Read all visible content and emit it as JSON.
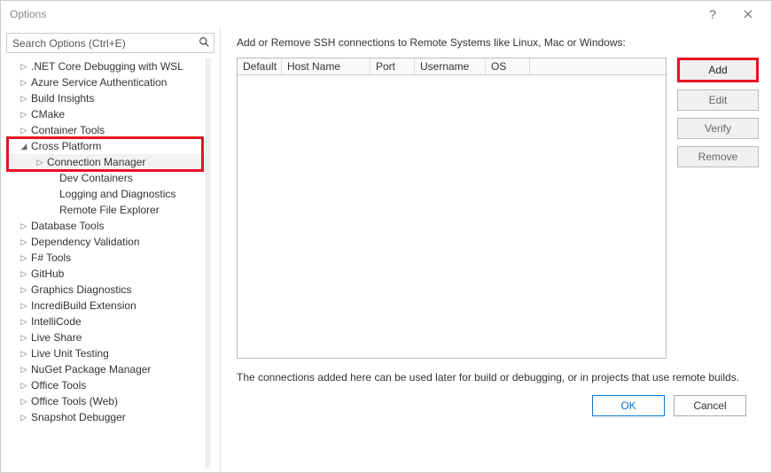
{
  "window": {
    "title": "Options"
  },
  "search": {
    "placeholder": "Search Options (Ctrl+E)"
  },
  "tree": {
    "items": [
      {
        "label": ".NET Core Debugging with WSL",
        "depth": 1,
        "arrow": "right"
      },
      {
        "label": "Azure Service Authentication",
        "depth": 1,
        "arrow": "right"
      },
      {
        "label": "Build Insights",
        "depth": 1,
        "arrow": "right"
      },
      {
        "label": "CMake",
        "depth": 1,
        "arrow": "right"
      },
      {
        "label": "Container Tools",
        "depth": 1,
        "arrow": "right"
      },
      {
        "label": "Cross Platform",
        "depth": 1,
        "arrow": "down",
        "expanded": true,
        "box": true
      },
      {
        "label": "Connection Manager",
        "depth": 2,
        "arrow": "right",
        "selected": true,
        "box": true
      },
      {
        "label": "Dev Containers",
        "depth": 2,
        "arrow": "none"
      },
      {
        "label": "Logging and Diagnostics",
        "depth": 2,
        "arrow": "none"
      },
      {
        "label": "Remote File Explorer",
        "depth": 2,
        "arrow": "none"
      },
      {
        "label": "Database Tools",
        "depth": 1,
        "arrow": "right"
      },
      {
        "label": "Dependency Validation",
        "depth": 1,
        "arrow": "right"
      },
      {
        "label": "F# Tools",
        "depth": 1,
        "arrow": "right"
      },
      {
        "label": "GitHub",
        "depth": 1,
        "arrow": "right"
      },
      {
        "label": "Graphics Diagnostics",
        "depth": 1,
        "arrow": "right"
      },
      {
        "label": "IncrediBuild Extension",
        "depth": 1,
        "arrow": "right"
      },
      {
        "label": "IntelliCode",
        "depth": 1,
        "arrow": "right"
      },
      {
        "label": "Live Share",
        "depth": 1,
        "arrow": "right"
      },
      {
        "label": "Live Unit Testing",
        "depth": 1,
        "arrow": "right"
      },
      {
        "label": "NuGet Package Manager",
        "depth": 1,
        "arrow": "right"
      },
      {
        "label": "Office Tools",
        "depth": 1,
        "arrow": "right"
      },
      {
        "label": "Office Tools (Web)",
        "depth": 1,
        "arrow": "right"
      },
      {
        "label": "Snapshot Debugger",
        "depth": 1,
        "arrow": "right"
      }
    ]
  },
  "rightPane": {
    "topText": "Add or Remove SSH connections to Remote Systems like Linux, Mac or Windows:",
    "columns": {
      "c0": "Default",
      "c1": "Host Name",
      "c2": "Port",
      "c3": "Username",
      "c4": "OS"
    },
    "buttons": {
      "add": "Add",
      "edit": "Edit",
      "verify": "Verify",
      "remove": "Remove"
    },
    "bottomText": "The connections added here can be used later for build or debugging, or in projects that use remote builds."
  },
  "footer": {
    "ok": "OK",
    "cancel": "Cancel"
  }
}
